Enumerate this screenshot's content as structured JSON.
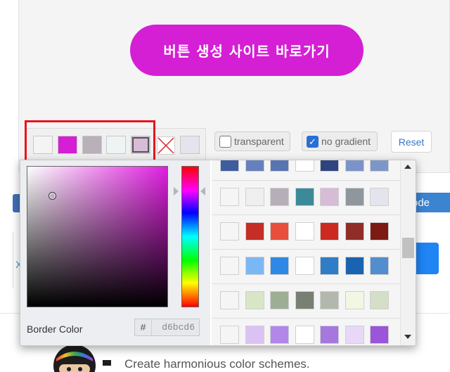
{
  "preview": {
    "button_label": "버튼 생성 사이트 바로가기",
    "button_color": "#d41fd4"
  },
  "swatches": {
    "colors": [
      "#f4f4f4",
      "#d41fd4",
      "#b9b0b9",
      "#eef4f4",
      "#d6bcd6"
    ],
    "active_index": 4,
    "extra_color": "#e4e4ee"
  },
  "options": {
    "transparent_label": "transparent",
    "transparent_checked": false,
    "no_gradient_label": "no gradient",
    "no_gradient_checked": true,
    "reset_label": "Reset"
  },
  "background_page": {
    "code_button_label": "ode",
    "fragment_letter": "X",
    "tagline": "Create harmonious color schemes."
  },
  "picker": {
    "border_label": "Border Color",
    "hex_prefix": "#",
    "hex_value": "d6bcd6",
    "hue_color": "#e01ee0"
  },
  "palette": [
    [
      "#3e5d9e",
      "#6680bd",
      "#5a74b2",
      "#ffffff",
      "#2f437e",
      "#7c93c9",
      "#7d96c6"
    ],
    [
      "#f5f5f5",
      "#efefef",
      "#b7afb8",
      "#3a8a99",
      "#d6bcd6",
      "#8f979c",
      "#e4e4ee"
    ],
    [
      "#f5f5f5",
      "#c42e27",
      "#e84e3b",
      "#ffffff",
      "#cc2921",
      "#8f2e27",
      "#7d1a14"
    ],
    [
      "#f5f5f5",
      "#7ab8f5",
      "#2e88e6",
      "#ffffff",
      "#2f7cc7",
      "#1b63b0",
      "#528dcf"
    ],
    [
      "#f5f5f5",
      "#d8e6c6",
      "#9caf95",
      "#778072",
      "#b3b8ad",
      "#f0f7e2",
      "#d3dfc6"
    ],
    [
      "#f5f5f5",
      "#dcc2f4",
      "#b387ea",
      "#ffffff",
      "#a777e0",
      "#e8d8f8",
      "#9a55d8"
    ]
  ]
}
